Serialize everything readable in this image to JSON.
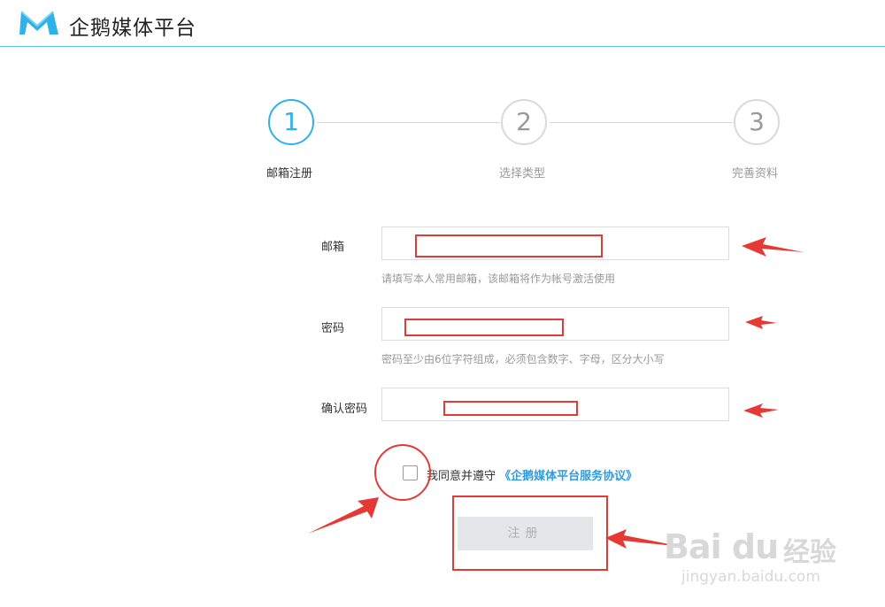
{
  "header": {
    "logo_icon": "qq-media-logo-icon",
    "brand_text": "企鹅媒体平台",
    "accent_color": "#2fb2e8"
  },
  "steps": [
    {
      "number": "1",
      "label": "邮箱注册",
      "active": true
    },
    {
      "number": "2",
      "label": "选择类型",
      "active": false
    },
    {
      "number": "3",
      "label": "完善资料",
      "active": false
    }
  ],
  "form": {
    "email": {
      "label": "邮箱",
      "value": "",
      "hint": "请填写本人常用邮箱，该邮箱将作为帐号激活使用"
    },
    "password": {
      "label": "密码",
      "value": "",
      "hint": "密码至少由6位字符组成，必须包含数字、字母，区分大小写"
    },
    "confirm_password": {
      "label": "确认密码",
      "value": ""
    },
    "agreement": {
      "checked": false,
      "text": "我同意并遵守",
      "link_text": "《企鹅媒体平台服务协议》"
    },
    "submit_label": "注册"
  },
  "watermark": {
    "brand": "Bai du",
    "cn": "经验",
    "url": "jingyan.baidu.com"
  },
  "annotation_color": "#e53935"
}
